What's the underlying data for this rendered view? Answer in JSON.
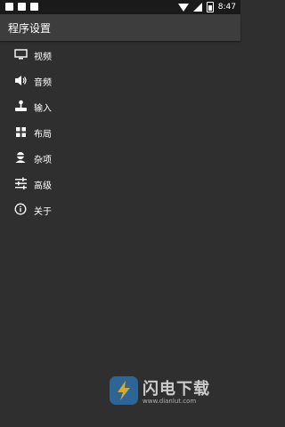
{
  "status_bar": {
    "time": "8:47",
    "icons": [
      "notification-square-icon",
      "notification-square-icon",
      "notification-square-icon",
      "wifi-icon",
      "signal-icon",
      "battery-icon"
    ]
  },
  "header": {
    "title": "程序设置"
  },
  "menu": {
    "items": [
      {
        "label": "视频",
        "icon": "monitor-icon"
      },
      {
        "label": "音频",
        "icon": "speaker-icon"
      },
      {
        "label": "输入",
        "icon": "joystick-icon"
      },
      {
        "label": "布局",
        "icon": "grid-icon"
      },
      {
        "label": "杂项",
        "icon": "misc-icon"
      },
      {
        "label": "高级",
        "icon": "sliders-icon"
      },
      {
        "label": "关于",
        "icon": "info-icon"
      }
    ]
  },
  "watermark": {
    "title": "闪电下载",
    "url": "www.dianlut.com"
  },
  "colors": {
    "background": "#2f2f2f",
    "header": "#3d3d3d",
    "status_bar": "#1a1a1a",
    "text": "#ffffff"
  }
}
